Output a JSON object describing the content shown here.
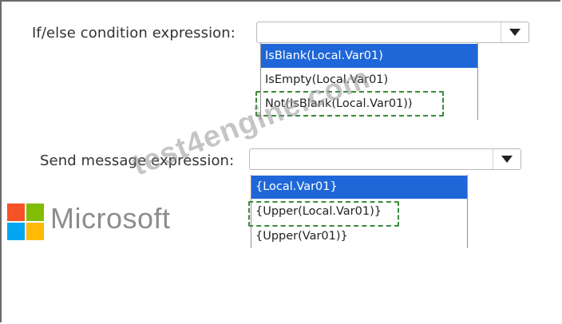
{
  "form": {
    "ifelse_label": "If/else condition expression:",
    "ifelse_value": "",
    "ifelse_options": [
      "IsBlank(Local.Var01)",
      "IsEmpty(Local.Var01)",
      "Not(IsBlank(Local.Var01))"
    ],
    "ifelse_selected_index": 0,
    "ifelse_highlighted_index": 2,
    "send_label": "Send message expression:",
    "send_value": "",
    "send_options": [
      "{Local.Var01}",
      "{Upper(Local.Var01)}",
      "{Upper(Var01)}"
    ],
    "send_selected_index": 0,
    "send_highlighted_index": 1
  },
  "branding": {
    "microsoft_text": "Microsoft",
    "logo_colors": [
      "#f35325",
      "#81bc06",
      "#05a6f0",
      "#ffba08"
    ],
    "watermark_text": "test4engine.com"
  },
  "colors": {
    "selection": "#1f67d8",
    "highlight_border": "#3a8a3a"
  }
}
